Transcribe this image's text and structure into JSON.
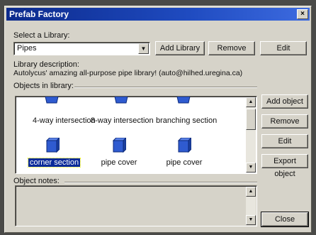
{
  "window": {
    "title": "Prefab Factory",
    "close_glyph": "×"
  },
  "library": {
    "select_label": "Select a Library:",
    "selected": "Pipes",
    "add_label": "Add Library",
    "remove_label": "Remove",
    "edit_label": "Edit",
    "description_label": "Library description:",
    "description": "Autolycus' amazing all-purpose pipe library! (auto@hilhed.uregina.ca)"
  },
  "objects": {
    "group_label": "Objects in library:",
    "items": [
      {
        "label": "4-way intersection",
        "selected": false
      },
      {
        "label": "8-way intersection",
        "selected": false
      },
      {
        "label": "branching section",
        "selected": false
      },
      {
        "label": "corner section",
        "selected": true
      },
      {
        "label": "pipe cover",
        "selected": false
      },
      {
        "label": "pipe cover",
        "selected": false
      }
    ],
    "buttons": {
      "add": "Add object",
      "remove": "Remove",
      "edit": "Edit",
      "export": "Export object"
    }
  },
  "notes": {
    "label": "Object notes:",
    "value": ""
  },
  "footer": {
    "close_label": "Close"
  },
  "colors": {
    "cube": "#2f5bd0",
    "selection": "#0a2a9a"
  }
}
